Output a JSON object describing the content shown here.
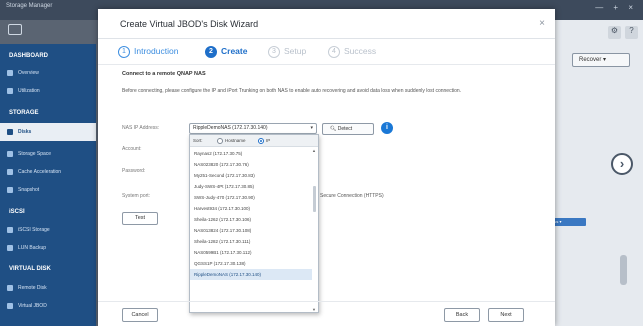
{
  "app": {
    "title": "Storage Manager",
    "window_controls": "— + ×"
  },
  "sidebar": {
    "sections": [
      {
        "heading": "DASHBOARD",
        "items": [
          "Overview",
          "Utilization"
        ]
      },
      {
        "heading": "STORAGE",
        "items": [
          "Disks",
          "Storage Space",
          "Cache Acceleration",
          "Snapshot"
        ]
      },
      {
        "heading": "iSCSI",
        "items": [
          "iSCSI Storage",
          "LUN Backup"
        ]
      },
      {
        "heading": "VIRTUAL DISK",
        "items": [
          "Remote Disk",
          "Virtual JBOD"
        ]
      }
    ],
    "active_item": "Disks"
  },
  "right_pane": {
    "recover_label": "Recover ▾",
    "chip_label": "Status ▾"
  },
  "wizard": {
    "title": "Create Virtual JBOD's Disk Wizard",
    "close_glyph": "×",
    "steps": [
      {
        "num": "1",
        "label": "Introduction",
        "state": "done"
      },
      {
        "num": "2",
        "label": "Create",
        "state": "current"
      },
      {
        "num": "3",
        "label": "Setup",
        "state": "todo"
      },
      {
        "num": "4",
        "label": "Success",
        "state": "todo"
      }
    ],
    "section_title": "Connect to a remote QNAP NAS",
    "description": "Before connecting, please configure the IP and iPort Trunking on both NAS to enable auto recovering and avoid data loss when suddenly lost connection.",
    "fields": {
      "nas_ip_label": "NAS IP Address:",
      "account_label": "Account:",
      "password_label": "Password:",
      "system_port_label": "System port:",
      "selected_ip": "RippleDemoNAS (172.17.30.140)",
      "detect_label": "Detect",
      "secure_label": "Secure Connection (HTTPS)",
      "test_label": "Test"
    },
    "dropdown": {
      "sort_label": "Sort:",
      "sort_hostname": "Hostname",
      "sort_ip": "IP",
      "sort_selected": "IP",
      "items": [
        "Raynas2 (172.17.30.75)",
        "NAS023820 (172.17.30.76)",
        "My251-Second (172.17.30.83)",
        "Judy-SWS-4Pt (172.17.30.85)",
        "SWS-Judy-470 (172.17.30.90)",
        "Harvest934 (172.17.30.100)",
        "Sheila-1262 (172.17.30.106)",
        "NAS013824 (172.17.30.108)",
        "Sheila-1282 (172.17.30.111)",
        "NAS0599B1 (172.17.30.112)",
        "QGSS1P (172.17.30.138)",
        "RippleDemoNAS (172.17.30.140)"
      ],
      "selected_index": 11
    },
    "footer": {
      "cancel": "Cancel",
      "back": "Back",
      "next": "Next"
    }
  }
}
